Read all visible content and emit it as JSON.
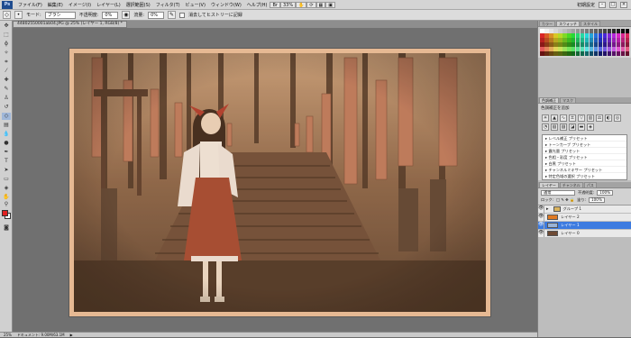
{
  "app": {
    "logo": "Ps"
  },
  "menu": {
    "items": [
      "ファイル(F)",
      "編集(E)",
      "イメージ(I)",
      "レイヤー(L)",
      "選択範囲(S)",
      "フィルタ(T)",
      "ビュー(V)",
      "ウィンドウ(W)",
      "ヘルプ(H)"
    ],
    "zoom_select": "33%",
    "workspace": "初期設定"
  },
  "options": {
    "mode_label": "モード:",
    "mode_value": "ブラシ",
    "opacity_label": "不透明度:",
    "opacity_value": "0%",
    "flow_label": "流量:",
    "flow_value": "0%",
    "history_label": "消去してヒストリーに記録"
  },
  "document": {
    "tab_title": "44802550001ab04.JPG @ 25% (レイヤー 1, RGB/8) *"
  },
  "status": {
    "zoom": "25%",
    "doc_info": "ドキュメント: 9.00M/63.1M"
  },
  "panels": {
    "swatches": {
      "tabs": [
        "カラー",
        "スウォッチ",
        "スタイル"
      ]
    },
    "adjustments": {
      "tabs": [
        "色調補正",
        "マスク"
      ],
      "title": "色調補正を追加",
      "presets": [
        "レベル補正 プリセット",
        "トーンカーブ プリセット",
        "露光量 プリセット",
        "色相・彩度 プリセット",
        "白黒 プリセット",
        "チャンネルミキサー プリセット",
        "特定色域の選択 プリセット"
      ]
    },
    "layers": {
      "tabs": [
        "レイヤー",
        "チャンネル",
        "パス"
      ],
      "blend_mode": "通常",
      "opacity_label": "不透明度:",
      "opacity_value": "100%",
      "lock_label": "ロック:",
      "fill_label": "塗り:",
      "fill_value": "100%",
      "rows": [
        {
          "name": "グループ 1"
        },
        {
          "name": "レイヤー 2"
        },
        {
          "name": "レイヤー 1"
        },
        {
          "name": "レイヤー 0"
        }
      ]
    }
  }
}
